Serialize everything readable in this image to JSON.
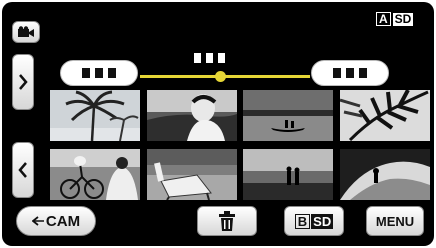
{
  "status": {
    "quality_prefix": "A",
    "quality_label": "SD"
  },
  "top_icon": "movie-camera-icon",
  "nav": {
    "next_icon": "chevron-right-icon",
    "prev_icon": "chevron-left-icon"
  },
  "thumbnails": [
    {
      "name": "thumb-palm-tree",
      "scene": "palm tree silhouette"
    },
    {
      "name": "thumb-woman-beach",
      "scene": "person on beach"
    },
    {
      "name": "thumb-canoe-sunset",
      "scene": "canoe on lake"
    },
    {
      "name": "thumb-palm-leaves",
      "scene": "palm leaves"
    },
    {
      "name": "thumb-cyclists",
      "scene": "cyclists"
    },
    {
      "name": "thumb-beach-chair",
      "scene": "beach chair"
    },
    {
      "name": "thumb-couple-beach",
      "scene": "couple on beach"
    },
    {
      "name": "thumb-wave-surfer",
      "scene": "waves"
    }
  ],
  "bottom": {
    "cam_label": "CAM",
    "menu_label": "MENU",
    "quality_prefix": "B",
    "quality_label": "SD"
  }
}
